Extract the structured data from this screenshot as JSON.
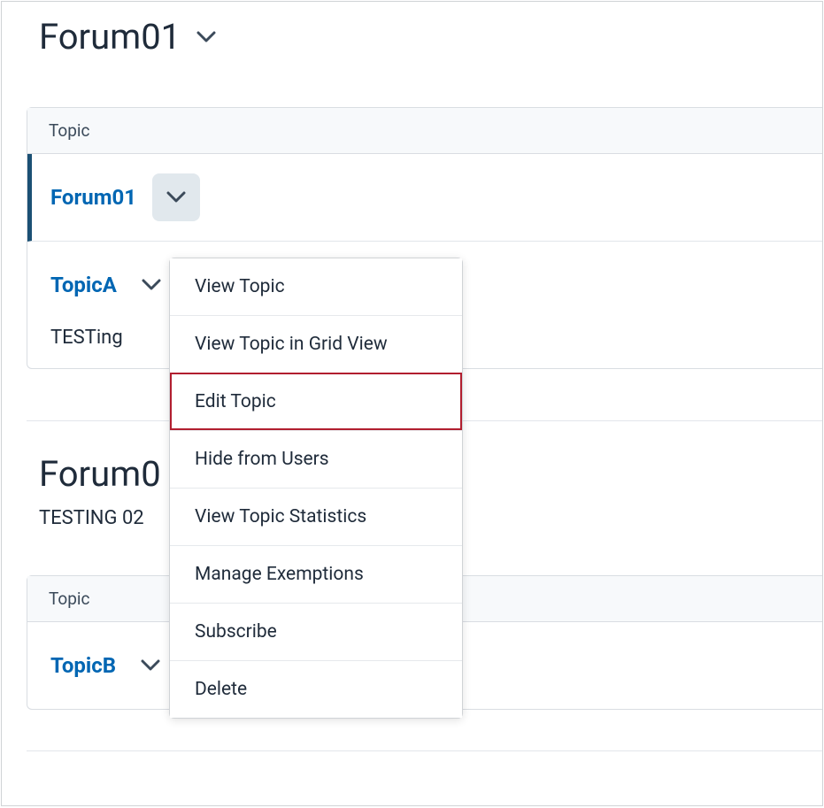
{
  "forums": [
    {
      "title": "Forum01",
      "topic_header": "Topic",
      "rows": [
        {
          "link": "Forum01",
          "selected": true,
          "menu_open": true
        },
        {
          "link": "TopicA",
          "desc": "TESTing"
        }
      ]
    },
    {
      "title": "Forum0",
      "desc": "TESTING 02",
      "topic_header": "Topic",
      "rows": [
        {
          "link": "TopicB"
        }
      ]
    }
  ],
  "dropdown": {
    "items": [
      "View Topic",
      "View Topic in Grid View",
      "Edit Topic",
      "Hide from Users",
      "View Topic Statistics",
      "Manage Exemptions",
      "Subscribe",
      "Delete"
    ],
    "highlight_index": 2
  }
}
